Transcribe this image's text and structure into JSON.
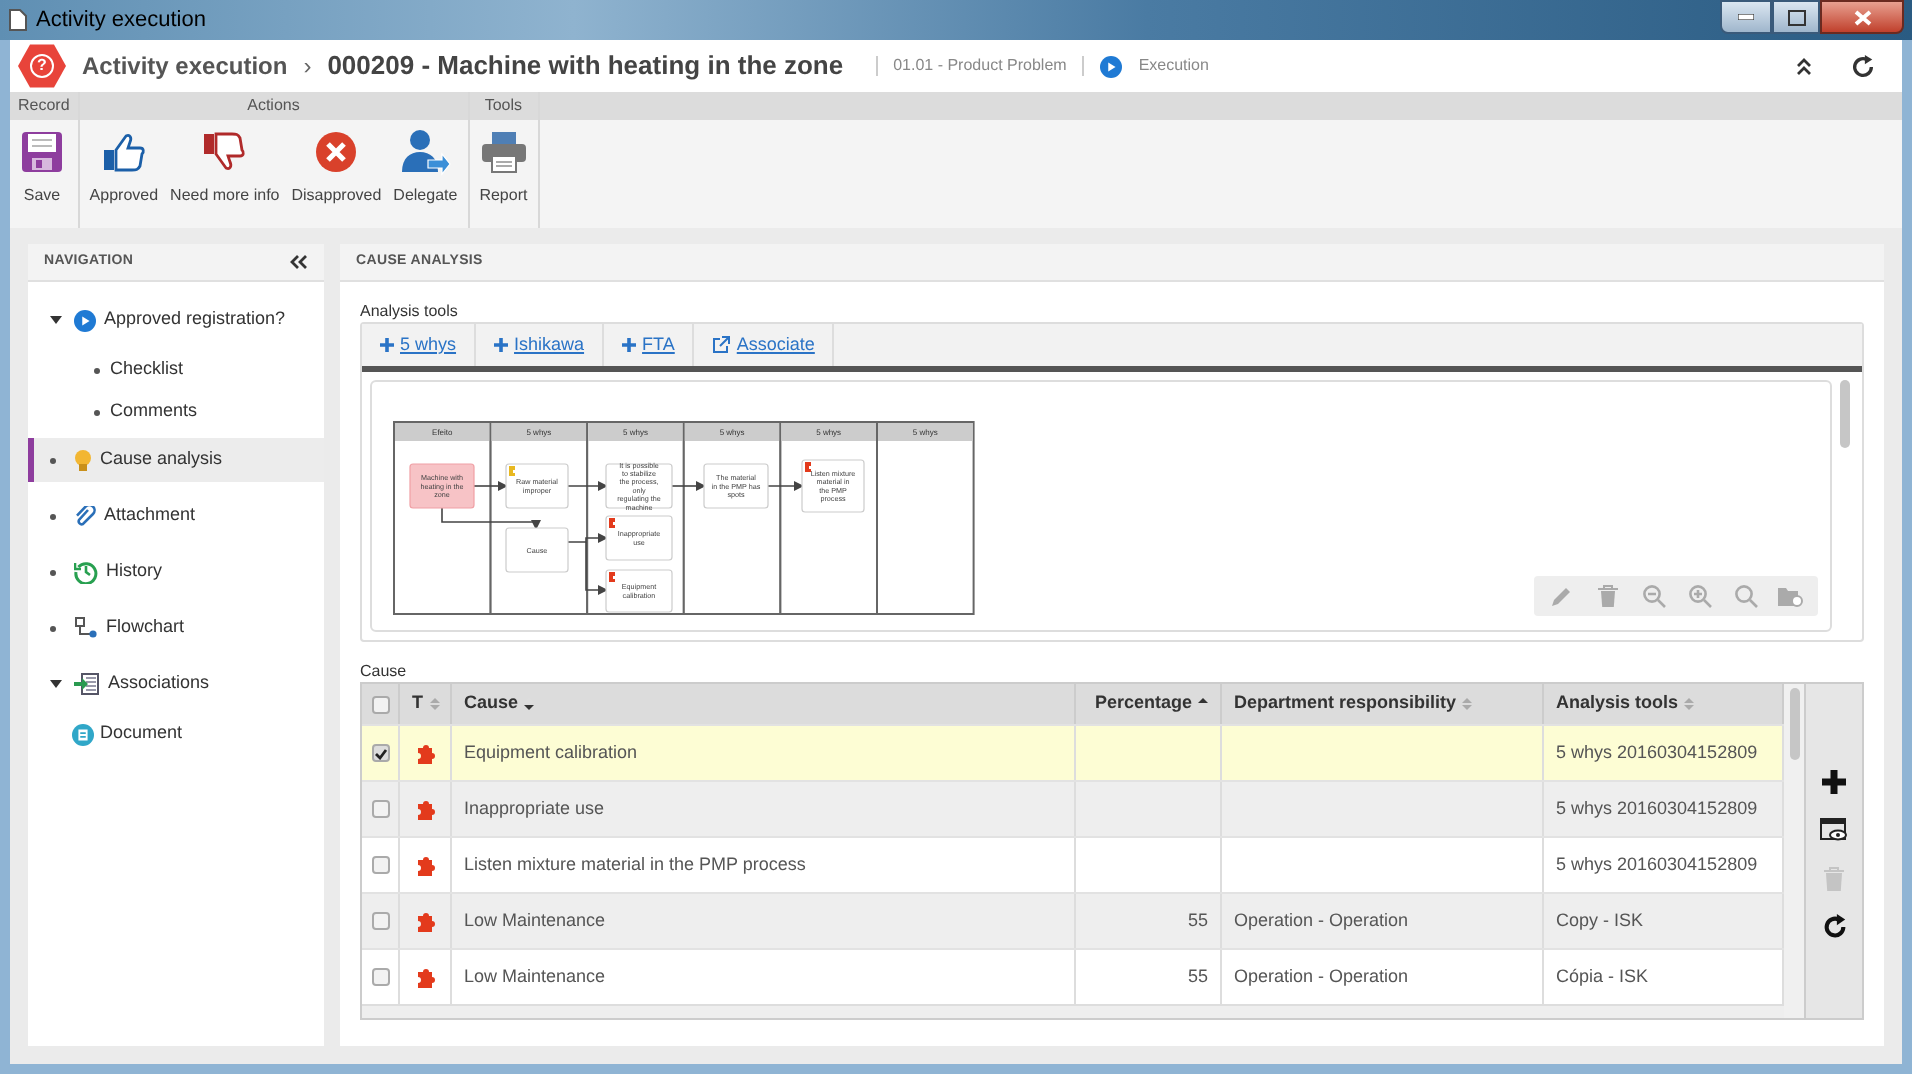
{
  "window": {
    "title": "Activity execution"
  },
  "header": {
    "logo_symbol": "?",
    "breadcrumb": "Activity execution",
    "separator": "›",
    "title": "000209 - Machine with heating in the zone",
    "category": "01.01 - Product Problem",
    "status": "Execution"
  },
  "toolbar": {
    "groups": [
      {
        "label": "Record",
        "buttons": [
          {
            "label": "Save",
            "kind": "save"
          }
        ]
      },
      {
        "label": "Actions",
        "buttons": [
          {
            "label": "Approved",
            "kind": "approve"
          },
          {
            "label": "Need more info",
            "kind": "more_info"
          },
          {
            "label": "Disapproved",
            "kind": "disapprove"
          },
          {
            "label": "Delegate",
            "kind": "delegate"
          }
        ]
      },
      {
        "label": "Tools",
        "buttons": [
          {
            "label": "Report",
            "kind": "report"
          }
        ]
      }
    ]
  },
  "navigation": {
    "title": "NAVIGATION",
    "items": [
      {
        "label": "Approved registration?",
        "selected": false,
        "expanded": true,
        "children": [
          {
            "label": "Checklist"
          },
          {
            "label": "Comments"
          }
        ]
      },
      {
        "label": "Cause analysis",
        "selected": true
      },
      {
        "label": "Attachment",
        "selected": false
      },
      {
        "label": "History",
        "selected": false
      },
      {
        "label": "Flowchart",
        "selected": false
      },
      {
        "label": "Associations",
        "selected": false,
        "expanded": true,
        "children": [
          {
            "label": "Document"
          }
        ]
      }
    ]
  },
  "cause_analysis": {
    "title": "CAUSE ANALYSIS",
    "tools_label": "Analysis tools",
    "tool_tabs": [
      {
        "label": "5 whys",
        "kind": "add"
      },
      {
        "label": "Ishikawa",
        "kind": "add"
      },
      {
        "label": "FTA",
        "kind": "add"
      },
      {
        "label": "Associate",
        "kind": "link"
      }
    ],
    "diagram": {
      "lanes": [
        "Efeito",
        "5 whys",
        "5 whys",
        "5 whys",
        "5 whys",
        "5 whys"
      ],
      "nodes": [
        {
          "text": "Machine with heating in the zone",
          "kind": "effect"
        },
        {
          "text": "Raw material improper",
          "kind": "why",
          "color": "#e8b820"
        },
        {
          "text": "It is possible to stabilize the process, only regulating the machine",
          "kind": "why"
        },
        {
          "text": "The material in the PMP has spots",
          "kind": "why"
        },
        {
          "text": "Listen mixture material in the PMP process",
          "kind": "why",
          "color": "#e33a1c"
        },
        {
          "text": "Cause",
          "kind": "why"
        },
        {
          "text": "Inappropriate use",
          "kind": "why",
          "color": "#e33a1c"
        },
        {
          "text": "Equipment calibration",
          "kind": "why",
          "color": "#e33a1c"
        }
      ]
    },
    "diagram_tools": [
      {
        "kind": "edit"
      },
      {
        "kind": "delete"
      },
      {
        "kind": "zoom_out"
      },
      {
        "kind": "zoom_in"
      },
      {
        "kind": "search"
      },
      {
        "kind": "folder"
      }
    ]
  },
  "cause_table": {
    "label": "Cause",
    "all_checked": false,
    "columns": [
      {
        "label": "T",
        "sorted": false
      },
      {
        "label": "Cause",
        "sorted": true,
        "descending": true
      },
      {
        "label": "Percentage",
        "sorted": true,
        "descending": false
      },
      {
        "label": "Department responsibility",
        "sorted": false
      },
      {
        "label": "Analysis tools",
        "sorted": false
      }
    ],
    "rows": [
      {
        "checked": true,
        "selected": true,
        "cause": "Equipment calibration",
        "tools": "5 whys 20160304152809"
      },
      {
        "checked": false,
        "selected": false,
        "cause": "Inappropriate use",
        "tools": "5 whys 20160304152809"
      },
      {
        "checked": false,
        "selected": false,
        "cause": "Listen mixture material in the PMP process",
        "tools": "5 whys 20160304152809"
      },
      {
        "checked": false,
        "selected": false,
        "cause": "Low Maintenance",
        "percentage": "55",
        "department": "Operation - Operation",
        "tools": "Copy - ISK"
      },
      {
        "checked": false,
        "selected": false,
        "cause": "Low Maintenance",
        "percentage": "55",
        "department": "Operation - Operation",
        "tools": "Cópia - ISK"
      }
    ],
    "actions": [
      {
        "kind": "add",
        "disabled": false
      },
      {
        "kind": "view",
        "disabled": false
      },
      {
        "kind": "delete",
        "disabled": true
      },
      {
        "kind": "refresh",
        "disabled": false
      }
    ]
  }
}
